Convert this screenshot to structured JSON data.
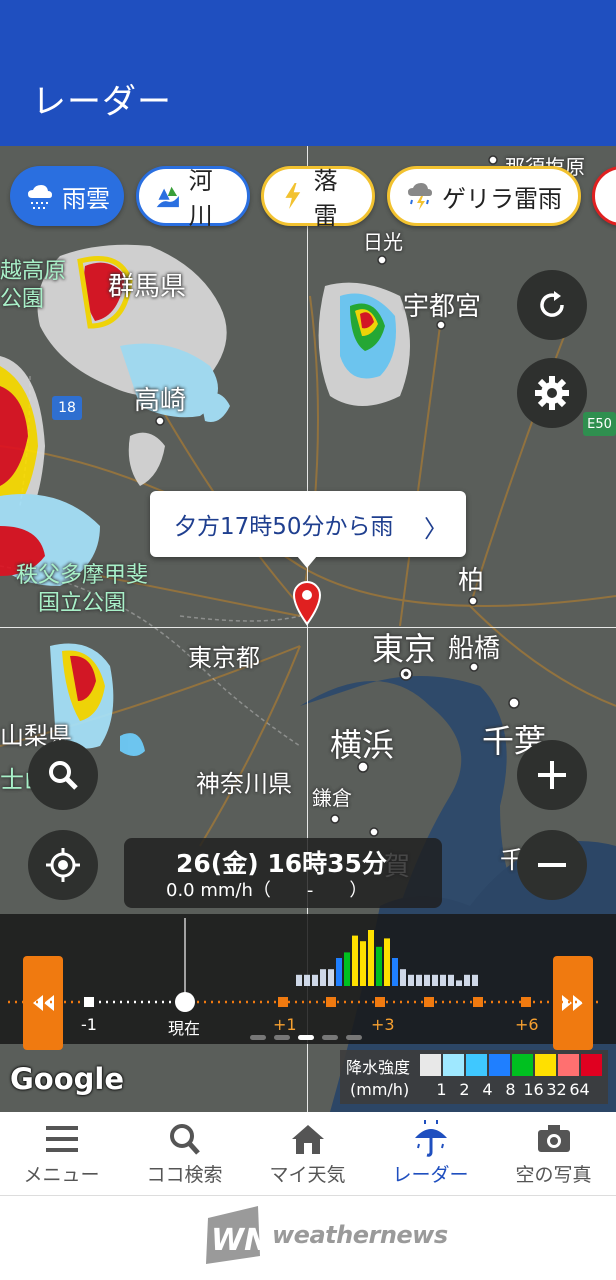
{
  "header": {
    "title": "レーダー"
  },
  "chips": [
    {
      "label": "雨雲",
      "icon": "rain-cloud-icon",
      "active": true
    },
    {
      "label": "河川",
      "icon": "river-icon",
      "active": false
    },
    {
      "label": "落雷",
      "icon": "lightning-icon",
      "active": false
    },
    {
      "label": "ゲリラ雷雨",
      "icon": "thunderstorm-icon",
      "active": false
    }
  ],
  "map": {
    "labels": {
      "nasushiobara": "那須塩原",
      "nikko": "日光",
      "utsunomiya": "宇都宮",
      "gunma": "群馬県",
      "joshinetsu": "越高原\n公園",
      "takasaki": "高崎",
      "chichibu": "秩父多摩甲斐\n国立公園",
      "kashiwa": "柏",
      "tokyo_to": "東京都",
      "tokyo": "東京",
      "funabashi": "船橋",
      "yamanashi": "山梨県",
      "yokohama": "横浜",
      "chiba": "千葉",
      "kanagawa": "神奈川県",
      "kamakura": "鎌倉",
      "chiba_ken": "千葉県",
      "fuji": "士山",
      "yokosuka": "賀"
    },
    "road_signs": {
      "e50": "E50",
      "r18": "18"
    },
    "callout": {
      "text": "夕方17時50分から雨",
      "arrow": "〉"
    }
  },
  "time_display": {
    "datetime": "26(金) 16時35分",
    "rain": "0.0 mm/h（　　-　　）"
  },
  "timeline": {
    "ticks": {
      "m1": "-1",
      "now": "現在",
      "p1": "+1",
      "p3": "+3",
      "p6": "+6"
    },
    "rewind_icon": "rewind-icon",
    "forward_icon": "fast-forward-icon",
    "bars": [
      0.2,
      0.2,
      0.2,
      0.3,
      0.3,
      0.5,
      0.6,
      0.9,
      0.8,
      1.0,
      0.7,
      0.85,
      0.5,
      0.3,
      0.2,
      0.2,
      0.2,
      0.2,
      0.2,
      0.2,
      0.1,
      0.2,
      0.2
    ]
  },
  "legend": {
    "title": "降水強度",
    "unit": "(mm/h)",
    "values": [
      "1",
      "2",
      "4",
      "8",
      "16",
      "32",
      "64"
    ],
    "colors": [
      "#e8e8e8",
      "#9fe8ff",
      "#3fc8ff",
      "#1f7fff",
      "#00c020",
      "#ffe000",
      "#ff7070",
      "#e00020"
    ]
  },
  "google": "Google",
  "bottom_nav": [
    {
      "label": "メニュー",
      "icon": "menu-icon",
      "active": false
    },
    {
      "label": "ココ検索",
      "icon": "search-icon",
      "active": false
    },
    {
      "label": "マイ天気",
      "icon": "home-icon",
      "active": false
    },
    {
      "label": "レーダー",
      "icon": "umbrella-icon",
      "active": true
    },
    {
      "label": "空の写真",
      "icon": "camera-icon",
      "active": false
    }
  ],
  "footer": {
    "brand": "weathernews"
  }
}
